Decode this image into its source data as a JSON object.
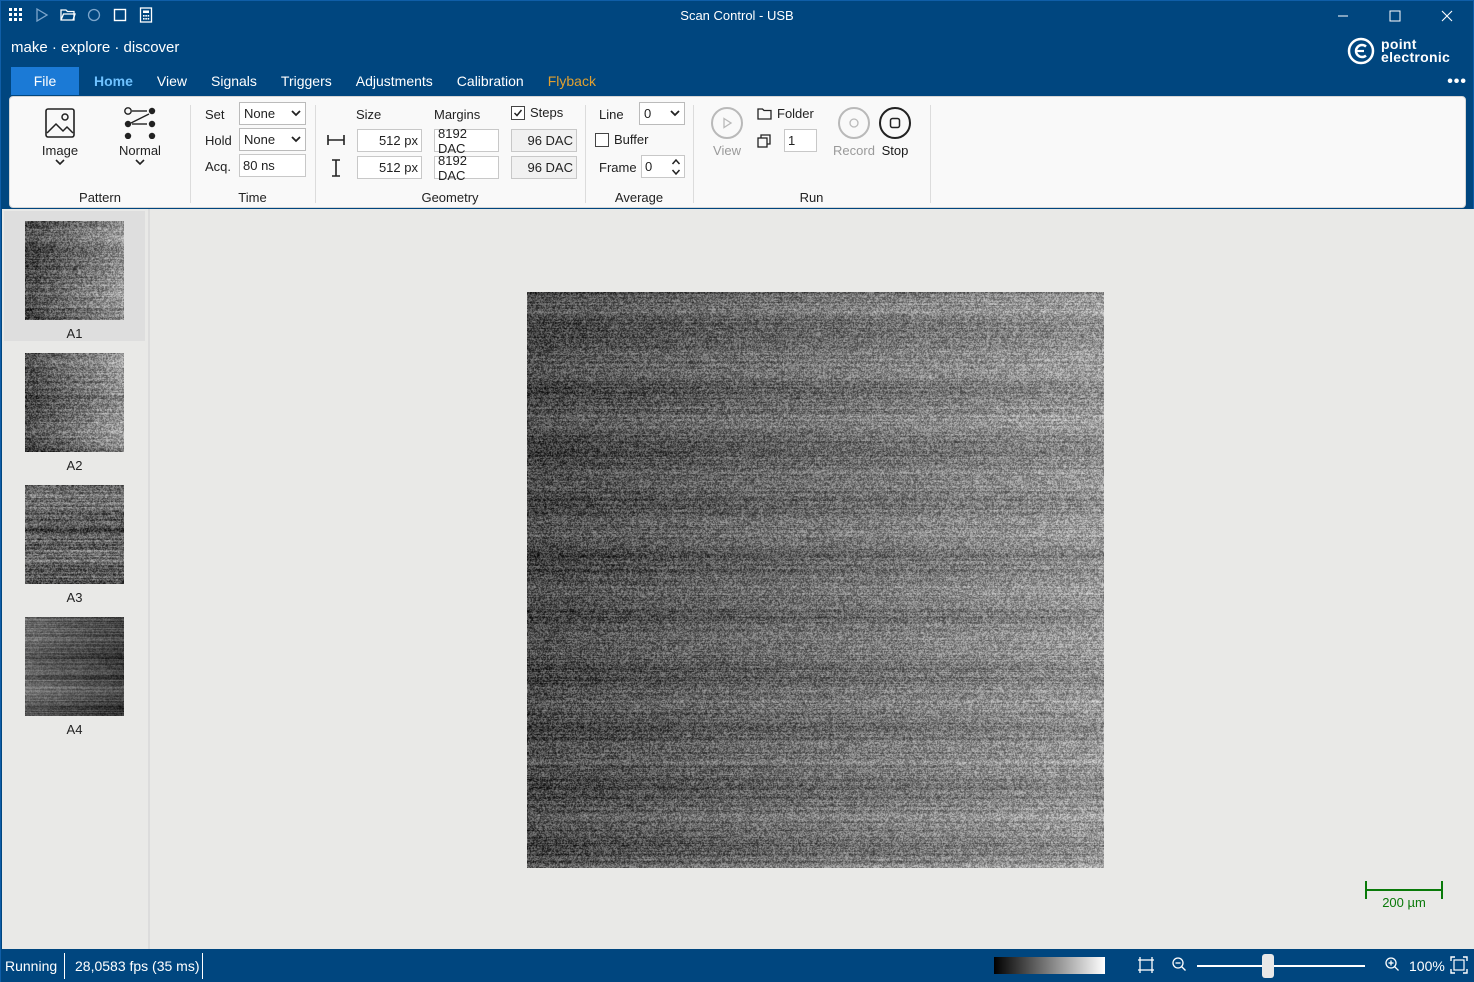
{
  "window": {
    "title": "Scan Control - USB"
  },
  "slogan": "make · explore · discover",
  "logo": {
    "line1": "point",
    "line2": "electronic"
  },
  "tabs": [
    {
      "label": "File"
    },
    {
      "label": "Home"
    },
    {
      "label": "View"
    },
    {
      "label": "Signals"
    },
    {
      "label": "Triggers"
    },
    {
      "label": "Adjustments"
    },
    {
      "label": "Calibration"
    },
    {
      "label": "Flyback"
    }
  ],
  "ribbon": {
    "pattern": {
      "label": "Pattern",
      "image_label": "Image",
      "normal_label": "Normal"
    },
    "time": {
      "label": "Time",
      "set_label": "Set",
      "set_value": "None",
      "hold_label": "Hold",
      "hold_value": "None",
      "acq_label": "Acq.",
      "acq_value": "80 ns"
    },
    "geometry": {
      "label": "Geometry",
      "size_label": "Size",
      "margins_label": "Margins",
      "steps_label": "Steps",
      "steps_checked": true,
      "size_x": "512 px",
      "size_y": "512 px",
      "margin_x": "8192 DAC",
      "margin_y": "8192 DAC",
      "steps_x": "96 DAC",
      "steps_y": "96 DAC"
    },
    "average": {
      "label": "Average",
      "line_label": "Line",
      "line_value": "0",
      "buffer_label": "Buffer",
      "buffer_checked": false,
      "frame_label": "Frame",
      "frame_value": "0"
    },
    "run": {
      "label": "Run",
      "view_label": "View",
      "folder_label": "Folder",
      "count_value": "1",
      "record_label": "Record",
      "stop_label": "Stop"
    }
  },
  "thumbnails": [
    {
      "label": "A1"
    },
    {
      "label": "A2"
    },
    {
      "label": "A3"
    },
    {
      "label": "A4"
    }
  ],
  "scalebar": {
    "label": "200 µm",
    "color": "#0a7a0a"
  },
  "status": {
    "state": "Running",
    "fps": "28,0583 fps (35 ms)",
    "zoom": "100%"
  },
  "colors": {
    "accent": "#00467f",
    "file_tab": "#1b7ad6",
    "active_tab": "#6fc2ff",
    "flyback_tab": "#e0a030"
  }
}
